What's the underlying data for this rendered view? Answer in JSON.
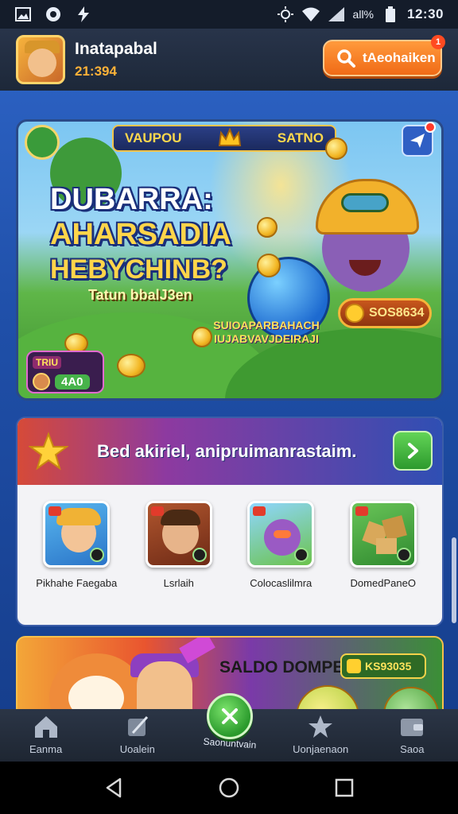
{
  "status_bar": {
    "time": "12:30",
    "battery_label": "all%",
    "icons": [
      "gallery-icon",
      "shazam-icon",
      "flash-icon",
      "brightness-icon",
      "wifi-icon",
      "signal-icon",
      "battery-icon"
    ]
  },
  "header": {
    "username": "Inatapabal",
    "score": "21:394",
    "search_label": "tAeohaiken",
    "notification_count": "1"
  },
  "hero_banner": {
    "title_left": "VAUPOU",
    "title_right": "SATNO",
    "headline_line1": "DUBARRA:",
    "headline_line2": "AHARSADIA",
    "headline_line3": "HEBYCHINB?",
    "subline": "Tatun bbalJ3en",
    "promo_text": "SUIOAPARBAHACH IUJABVAVJDEIRAJI",
    "coins": "SOS8634",
    "player_tag": "TRIU",
    "player_amount": "4A0"
  },
  "daily_section": {
    "title": "Bed akiriel, anipruimanrastaim.",
    "games": [
      {
        "name": "Pikhahe Faegaba",
        "thumb": "boy-thumb"
      },
      {
        "name": "Lsrlaih",
        "thumb": "man-thumb"
      },
      {
        "name": "Colocaslilmra",
        "thumb": "monster-thumb"
      },
      {
        "name": "DomedPaneO",
        "thumb": "blocks-thumb"
      }
    ]
  },
  "wallet": {
    "title": "SALDO DOMPET",
    "amount": "KS93035"
  },
  "bottom_nav": {
    "items": [
      {
        "label": "Eanma",
        "icon": "home-icon"
      },
      {
        "label": "Uoalein",
        "icon": "tools-icon"
      },
      {
        "label": "Uonjaenaon",
        "icon": "star-icon"
      },
      {
        "label": "Saoa",
        "icon": "wallet-icon"
      }
    ],
    "center_label": "Saonuntvain"
  },
  "colors": {
    "accent_orange": "#f06a16",
    "accent_green": "#2d9a2d",
    "gold": "#ffd54a",
    "navy": "#1d2839"
  }
}
